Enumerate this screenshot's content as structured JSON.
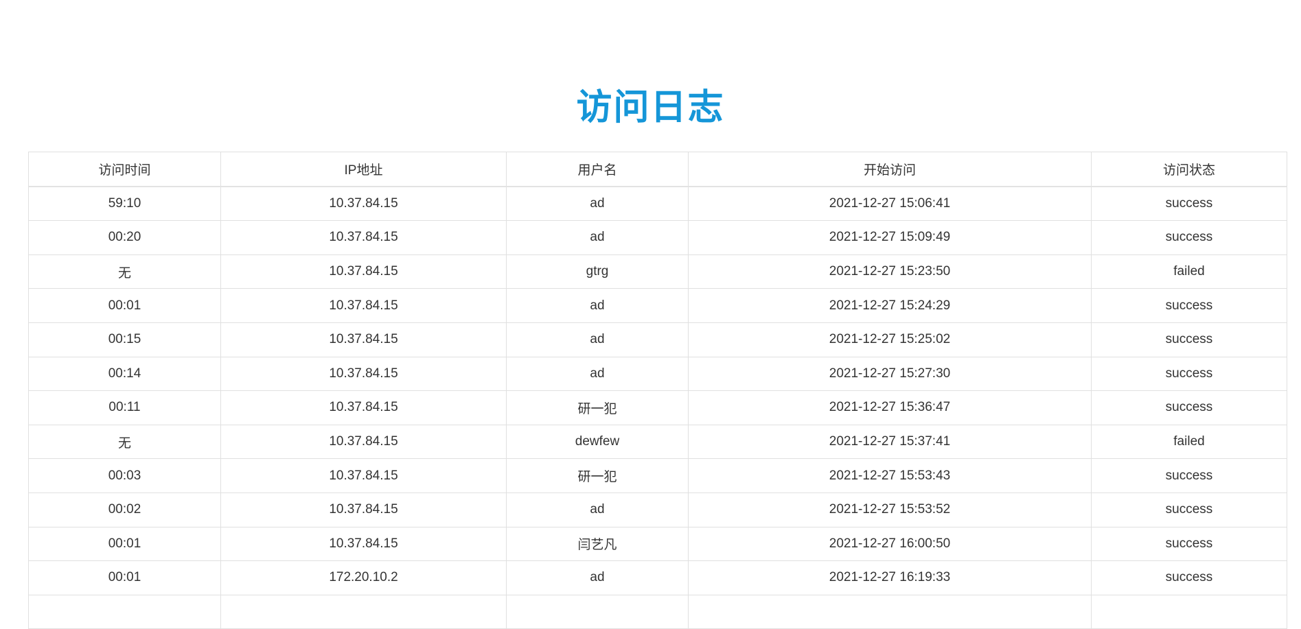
{
  "title": "访问日志",
  "table": {
    "headers": [
      "访问时间",
      "IP地址",
      "用户名",
      "开始访问",
      "访问状态"
    ],
    "rows": [
      [
        "59:10",
        "10.37.84.15",
        "ad",
        "2021-12-27 15:06:41",
        "success"
      ],
      [
        "00:20",
        "10.37.84.15",
        "ad",
        "2021-12-27 15:09:49",
        "success"
      ],
      [
        "无",
        "10.37.84.15",
        "gtrg",
        "2021-12-27 15:23:50",
        "failed"
      ],
      [
        "00:01",
        "10.37.84.15",
        "ad",
        "2021-12-27 15:24:29",
        "success"
      ],
      [
        "00:15",
        "10.37.84.15",
        "ad",
        "2021-12-27 15:25:02",
        "success"
      ],
      [
        "00:14",
        "10.37.84.15",
        "ad",
        "2021-12-27 15:27:30",
        "success"
      ],
      [
        "00:11",
        "10.37.84.15",
        "研一犯",
        "2021-12-27 15:36:47",
        "success"
      ],
      [
        "无",
        "10.37.84.15",
        "dewfew",
        "2021-12-27 15:37:41",
        "failed"
      ],
      [
        "00:03",
        "10.37.84.15",
        "研一犯",
        "2021-12-27 15:53:43",
        "success"
      ],
      [
        "00:02",
        "10.37.84.15",
        "ad",
        "2021-12-27 15:53:52",
        "success"
      ],
      [
        "00:01",
        "10.37.84.15",
        "闫艺凡",
        "2021-12-27 16:00:50",
        "success"
      ],
      [
        "00:01",
        "172.20.10.2",
        "ad",
        "2021-12-27 16:19:33",
        "success"
      ]
    ]
  },
  "colors": {
    "title": "#1596d8",
    "border": "#e0e0e0",
    "text": "#333333"
  }
}
